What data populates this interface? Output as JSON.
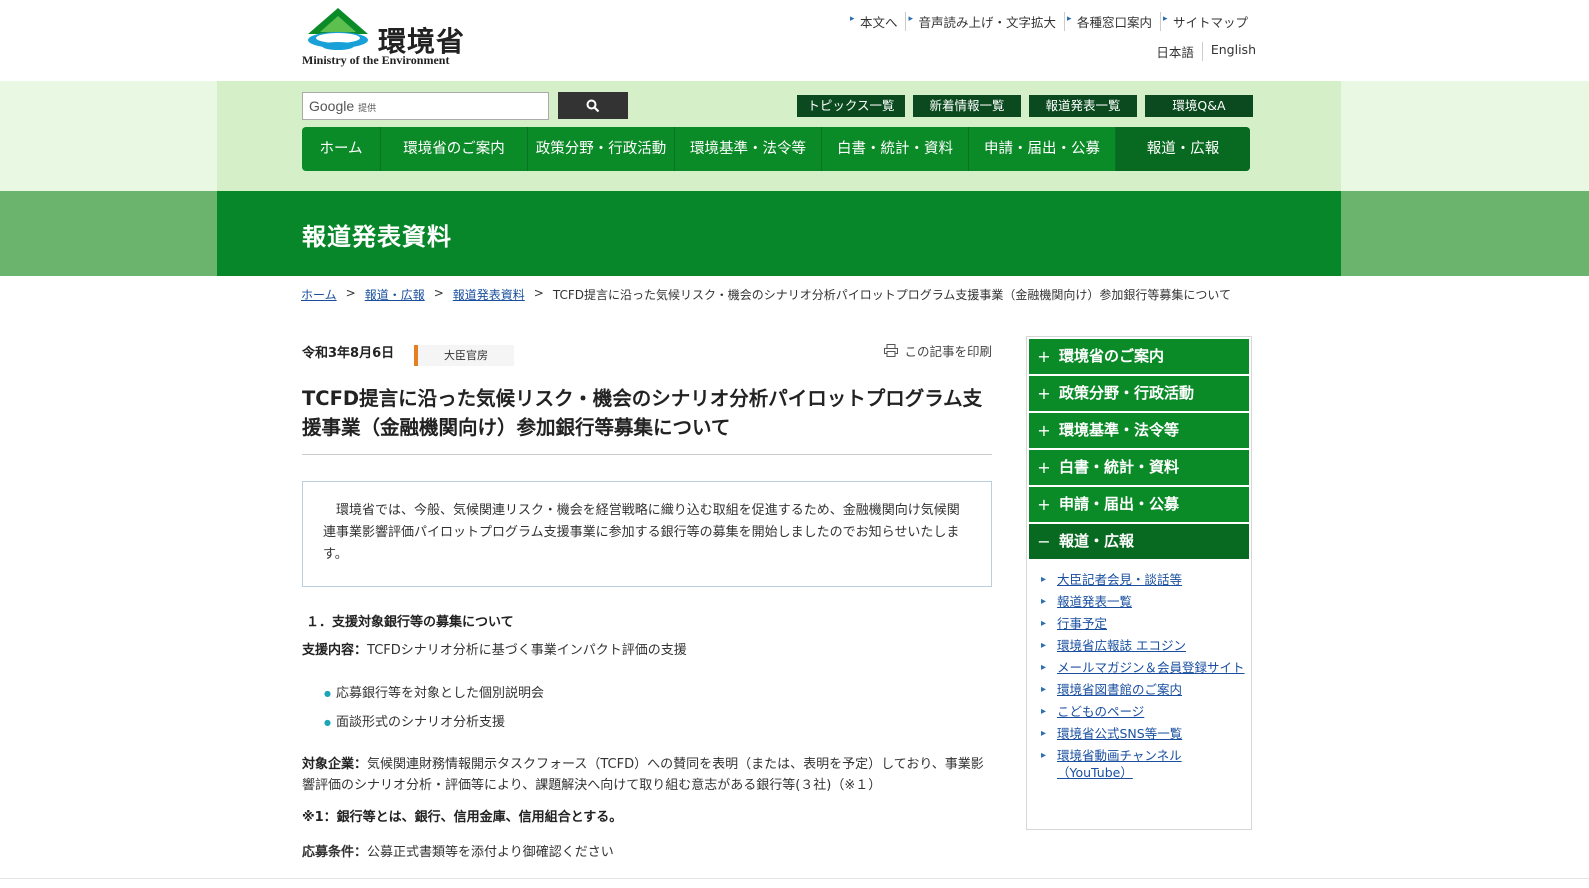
{
  "header": {
    "logo_jp": "環境省",
    "logo_en": "Ministry of the Environment",
    "util_links": [
      "本文へ",
      "音声読み上げ・文字拡大",
      "各種窓口案内",
      "サイトマップ"
    ],
    "languages": [
      "日本語",
      "English"
    ]
  },
  "search": {
    "placeholder_brand": "Google",
    "placeholder_suffix": "提供",
    "button_icon": "search-icon"
  },
  "quick_links": [
    "トピックス一覧",
    "新着情報一覧",
    "報道発表一覧",
    "環境Q&A"
  ],
  "global_nav": [
    "ホーム",
    "環境省のご案内",
    "政策分野・行政活動",
    "環境基準・法令等",
    "白書・統計・資料",
    "申請・届出・公募",
    "報道・広報"
  ],
  "page_title": "報道発表資料",
  "breadcrumb": {
    "links": [
      "ホーム",
      "報道・広報",
      "報道発表資料"
    ],
    "current": "TCFD提言に沿った気候リスク・機会のシナリオ分析パイロットプログラム支援事業（金融機関向け）参加銀行等募集について"
  },
  "article": {
    "date": "令和3年8月6日",
    "department": "大臣官房",
    "print_label": "この記事を印刷",
    "title": "TCFD提言に沿った気候リスク・機会のシナリオ分析パイロットプログラム支援事業（金融機関向け）参加銀行等募集について",
    "lead": "環境省では、今般、気候関連リスク・機会を経営戦略に織り込む取組を促進するため、金融機関向け気候関連事業影響評価パイロットプログラム支援事業に参加する銀行等の募集を開始しましたのでお知らせいたします。",
    "section1_heading": "１．支援対象銀行等の募集について",
    "support_label": "支援内容：",
    "support_text": "TCFDシナリオ分析に基づく事業インパクト評価の支援",
    "support_items": [
      "応募銀行等を対象とした個別説明会",
      "面談形式のシナリオ分析支援"
    ],
    "target_label": "対象企業：",
    "target_text": "気候関連財務情報開示タスクフォース（TCFD）への賛同を表明（または、表明を予定）しており、事業影響評価のシナリオ分析・評価等により、課題解決へ向けて取り組む意志がある銀行等(３社)（※１）",
    "note": "※1：銀行等とは、銀行、信用金庫、信用組合とする。",
    "condition_label": "応募条件：",
    "condition_text": "公募正式書類等を添付より御確認ください"
  },
  "sidebar": {
    "categories": [
      {
        "label": "環境省のご案内",
        "symbol": "+"
      },
      {
        "label": "政策分野・行政活動",
        "symbol": "+"
      },
      {
        "label": "環境基準・法令等",
        "symbol": "+"
      },
      {
        "label": "白書・統計・資料",
        "symbol": "+"
      },
      {
        "label": "申請・届出・公募",
        "symbol": "+"
      },
      {
        "label": "報道・広報",
        "symbol": "−"
      }
    ],
    "sub_links": [
      "大臣記者会見・談話等",
      "報道発表一覧",
      "行事予定",
      "環境省広報誌 エコジン",
      "メールマガジン＆会員登録サイト",
      "環境省図書館のご案内",
      "こどものページ",
      "環境省公式SNS等一覧",
      "環境省動画チャンネル（YouTube）"
    ]
  },
  "colors": {
    "primary_green": "#0b8a28",
    "dark_green": "#086a20",
    "light_band": "#d5f0c8",
    "accent_orange": "#e57f1f",
    "link_blue": "#1a4fa0"
  }
}
